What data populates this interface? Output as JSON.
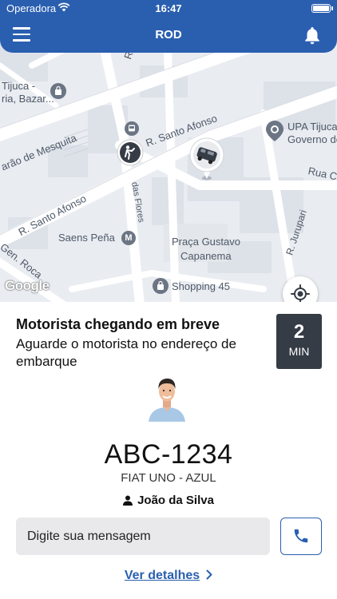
{
  "status_bar": {
    "carrier": "Operadora",
    "time": "16:47"
  },
  "header": {
    "title": "ROD",
    "menu_icon": "hamburger-menu-icon",
    "notification_icon": "bell-icon"
  },
  "map": {
    "labels": {
      "tijuca_shop": "Tijuca -",
      "bazar": "ria, Bazar...",
      "mesquita": "arão de Mesquita",
      "santo_afonso_top": "R. Santo Afonso",
      "santo_afonso_left": "R. Santo Afonso",
      "santo_afonso_mid": "R. Santo Afonso",
      "das_flores": "das Flores",
      "upa": "UPA Tijuca",
      "governo": "Governo de",
      "rua_c": "Rua C",
      "saens_pena": "Saens Peña",
      "metro_badge": "M",
      "praca_1": "Praça Gustavo",
      "praca_2": "Capanema",
      "jurupari": "R. Jurupari",
      "gen_roca": "Gen. Roca",
      "shopping": "Shopping 45",
      "r_top": "R."
    },
    "attribution": "Google",
    "locate_icon": "crosshair-icon"
  },
  "trip": {
    "status_title": "Motorista chegando em breve",
    "status_description": "Aguarde o motorista no endereço de embarque",
    "eta_value": "2",
    "eta_unit": "MIN",
    "plate": "ABC-1234",
    "car_model": "FIAT UNO - AZUL",
    "driver_name": "João da Silva"
  },
  "message": {
    "placeholder": "Digite sua mensagem",
    "call_icon": "phone-icon"
  },
  "details_link": "Ver detalhes",
  "colors": {
    "brand_blue": "#2a5fb0",
    "eta_bg": "#353c45",
    "input_bg": "#e9e9ec",
    "map_bg": "#e9ecf1"
  }
}
